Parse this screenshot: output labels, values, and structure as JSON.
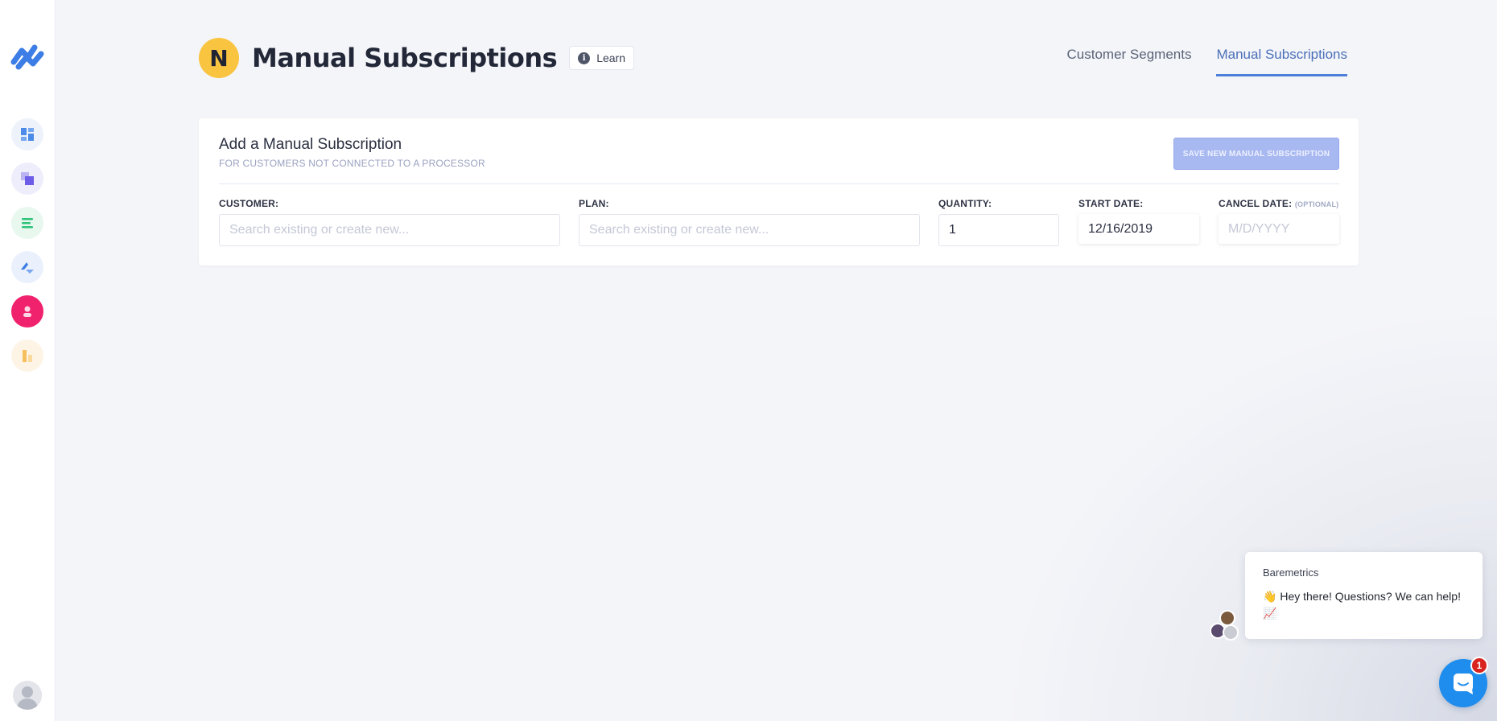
{
  "header": {
    "avatar_letter": "N",
    "title": "Manual Subscriptions",
    "learn_label": "Learn"
  },
  "tabs": [
    {
      "label": "Customer Segments",
      "active": false
    },
    {
      "label": "Manual Subscriptions",
      "active": true
    }
  ],
  "form": {
    "title": "Add a Manual Subscription",
    "subtitle": "FOR CUSTOMERS NOT CONNECTED TO A PROCESSOR",
    "save_label": "SAVE NEW MANUAL SUBSCRIPTION",
    "customer": {
      "label": "CUSTOMER:",
      "placeholder": "Search existing or create new...",
      "value": ""
    },
    "plan": {
      "label": "PLAN:",
      "placeholder": "Search existing or create new...",
      "value": ""
    },
    "quantity": {
      "label": "QUANTITY:",
      "value": "1"
    },
    "start_date": {
      "label": "START DATE:",
      "value": "12/16/2019"
    },
    "cancel_date": {
      "label": "CANCEL DATE:",
      "optional": "(OPTIONAL)",
      "placeholder": "M/D/YYYY",
      "value": ""
    }
  },
  "chat": {
    "sender": "Baremetrics",
    "message_emoji": "👋",
    "message": "Hey there!  Questions? We can help!",
    "trailing_emoji": "📈",
    "badge_count": "1"
  },
  "colors": {
    "accent": "#4d7fd8",
    "save_button": "#a8b8f0",
    "header_avatar": "#f9c440",
    "chat_launcher": "#1f8ded",
    "badge": "#d9231f"
  },
  "sidebar_icons": [
    "dashboard-icon",
    "layers-icon",
    "list-icon",
    "arrows-icon",
    "person-icon",
    "bar-chart-icon"
  ]
}
